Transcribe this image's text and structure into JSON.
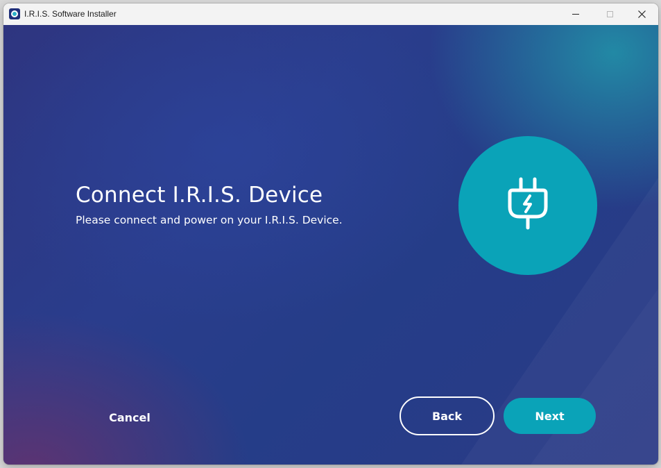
{
  "window": {
    "title": "I.R.I.S. Software Installer"
  },
  "page": {
    "heading": "Connect I.R.I.S. Device",
    "subheading": "Please connect and power on your I.R.I.S. Device.",
    "icon": "plug-icon"
  },
  "buttons": {
    "cancel": "Cancel",
    "back": "Back",
    "next": "Next"
  },
  "colors": {
    "accent": "#0aa3b8",
    "background": "#2a3a86",
    "text": "#ffffff"
  }
}
